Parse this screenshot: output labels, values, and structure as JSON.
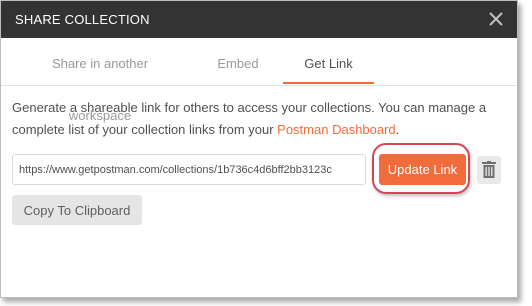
{
  "modal": {
    "title": "SHARE COLLECTION",
    "close_icon": "close-icon"
  },
  "tabs": [
    {
      "label": "Share in another workspace",
      "active": false
    },
    {
      "label": "Embed",
      "active": false
    },
    {
      "label": "Get Link",
      "active": true
    }
  ],
  "description": {
    "text": "Generate a shareable link for others to access your collections. You can manage a complete list of your collection links from your ",
    "link_text": "Postman Dashboard",
    "suffix": "."
  },
  "link_field": {
    "value": "https://www.getpostman.com/collections/1b736c4d6bff2bb3123c"
  },
  "buttons": {
    "update_label": "Update Link",
    "delete_icon": "trash-icon",
    "copy_label": "Copy To Clipboard"
  },
  "colors": {
    "accent": "#f26b3a",
    "titlebar": "#333333",
    "highlight_ring": "#d64553"
  }
}
